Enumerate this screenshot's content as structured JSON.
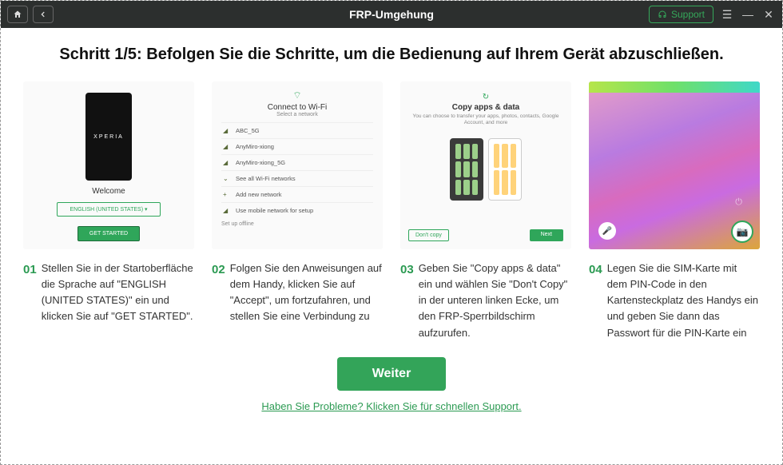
{
  "titlebar": {
    "title": "FRP-Umgehung",
    "support_label": "Support"
  },
  "heading": "Schritt 1/5: Befolgen Sie die Schritte, um die Bedienung auf Ihrem Gerät abzuschließen.",
  "steps": [
    {
      "num": "01",
      "text": "Stellen Sie in der Startoberfläche die Sprache auf \"ENGLISH (UNITED STATES)\" ein und klicken Sie auf \"GET STARTED\".",
      "img": {
        "brand": "XPERIA",
        "welcome": "Welcome",
        "language": "ENGLISH (UNITED STATES) ▾",
        "get_started": "GET STARTED"
      }
    },
    {
      "num": "02",
      "text": "Folgen Sie den Anweisungen auf dem Handy, klicken Sie auf \"Accept\", um fortzufahren, und stellen Sie eine Verbindung zu",
      "img": {
        "title": "Connect to Wi-Fi",
        "subtitle": "Select a network",
        "networks": [
          "ABC_5G",
          "AnyMiro-xiong",
          "AnyMiro-xiong_5G"
        ],
        "see_all": "See all Wi-Fi networks",
        "add_new": "Add new network",
        "use_mobile": "Use mobile network for setup",
        "offline": "Set up offline"
      }
    },
    {
      "num": "03",
      "text": "Geben Sie \"Copy apps & data\" ein und wählen Sie \"Don't Copy\" in der unteren linken Ecke, um den FRP-Sperrbildschirm aufzurufen.",
      "img": {
        "title": "Copy apps & data",
        "subtitle": "You can choose to transfer your apps, photos, contacts, Google Account, and more",
        "dont_copy": "Don't copy",
        "next": "Next"
      }
    },
    {
      "num": "04",
      "text": "Legen Sie die SIM-Karte mit dem PIN-Code in den Kartensteckplatz des Handys ein und geben Sie dann das Passwort für die PIN-Karte ein"
    }
  ],
  "footer": {
    "continue_label": "Weiter",
    "help_label": "Haben Sie Probleme? Klicken Sie für schnellen Support."
  }
}
